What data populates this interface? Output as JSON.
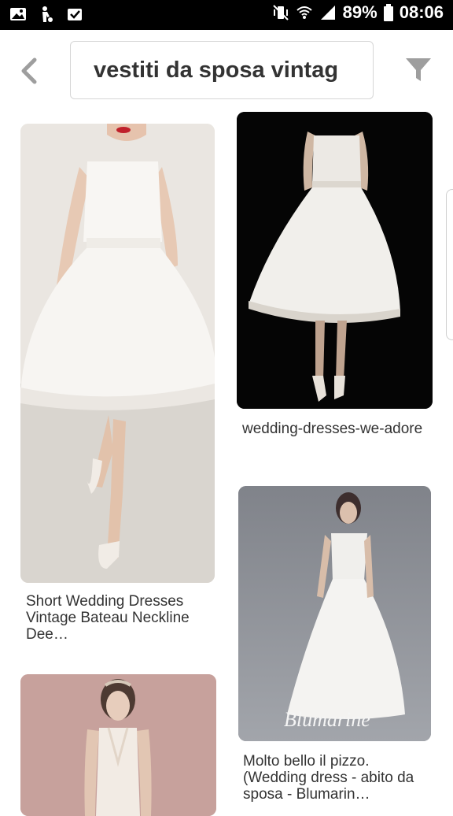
{
  "status_bar": {
    "battery_percent": "89%",
    "time": "08:06",
    "left_icons": [
      "image-icon",
      "hand-icon",
      "inbox-icon"
    ],
    "right_icons": [
      "vibrate-mute-icon",
      "wifi-icon",
      "signal-icon",
      "battery-icon"
    ]
  },
  "search": {
    "query": "vestiti da sposa vintag"
  },
  "icons": {
    "back": "chevron-left-icon",
    "filter": "filter-icon"
  },
  "colors": {
    "status_bar": "#000000",
    "icon_gray": "#9e9e9e",
    "text": "#333333"
  },
  "pins": [
    {
      "caption": "Short Wedding Dresses Vintage Bateau Neckline Dee…"
    },
    {
      "caption": "wedding-dresses-we-adore"
    },
    {
      "caption": "Molto bello il pizzo. (Wedding dress - abito da sposa - Blumarin…"
    },
    {
      "caption": ""
    }
  ],
  "watermark": "Blumarine"
}
